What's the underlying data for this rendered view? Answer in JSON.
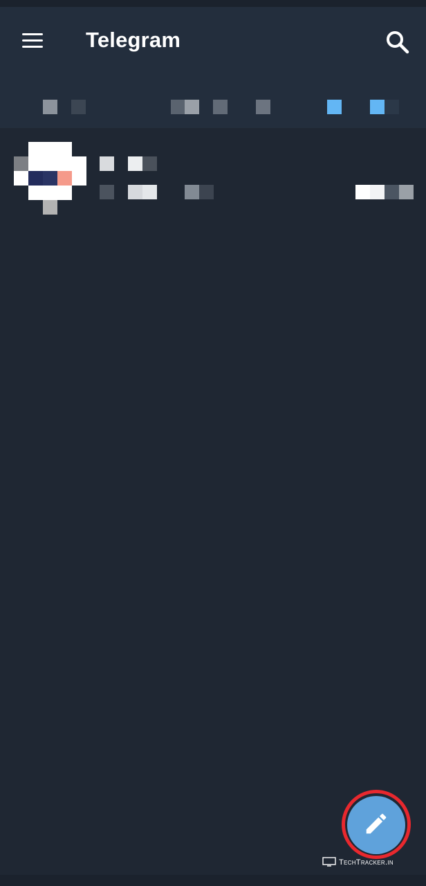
{
  "app": {
    "title": "Telegram"
  },
  "header": {
    "menu_icon": "hamburger-menu-icon",
    "search_icon": "search-icon"
  },
  "fab": {
    "icon": "pencil-icon",
    "accent": "#5fa2db",
    "highlight_ring": "#e8282e"
  },
  "watermark": {
    "text": "TechTracker.in"
  },
  "colors": {
    "background": "#1f2733",
    "header": "#232e3d",
    "text": "#ffffff"
  }
}
